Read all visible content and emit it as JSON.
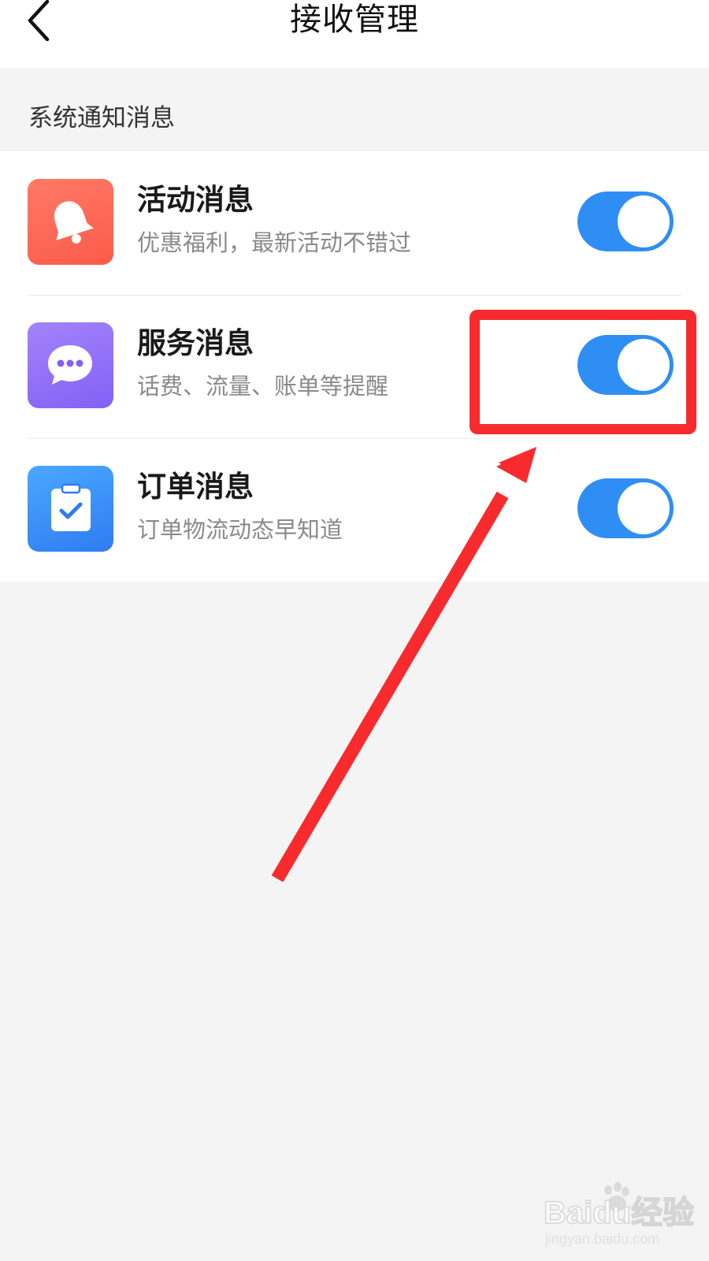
{
  "nav": {
    "title": "接收管理"
  },
  "section": {
    "header": "系统通知消息"
  },
  "items": [
    {
      "title": "活动消息",
      "subtitle": "优惠福利，最新活动不错过",
      "icon": "bell-icon",
      "enabled": true
    },
    {
      "title": "服务消息",
      "subtitle": "话费、流量、账单等提醒",
      "icon": "chat-bubble-icon",
      "enabled": true
    },
    {
      "title": "订单消息",
      "subtitle": "订单物流动态早知道",
      "icon": "clipboard-check-icon",
      "enabled": true
    }
  ],
  "watermark": {
    "brand": "Baidu经验",
    "url": "jingyan.baidu.com"
  },
  "colors": {
    "toggle_on": "#2f8ef4",
    "annotation": "#f72b2e",
    "activity_icon": "#fb5b4a",
    "service_icon": "#8261f5",
    "order_icon": "#2f7cf0"
  }
}
